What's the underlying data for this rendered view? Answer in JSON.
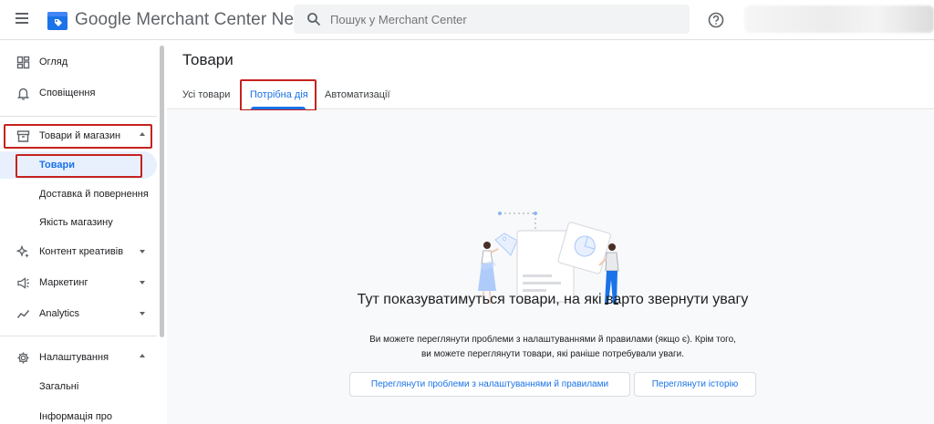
{
  "header": {
    "brand_google": "Google",
    "brand_product": "Merchant Center Next",
    "search_placeholder": "Пошук у Merchant Center",
    "icons": [
      "menu-icon",
      "merchant-center-logo",
      "search-icon",
      "help-icon"
    ]
  },
  "sidebar": {
    "overview": "Огляд",
    "notifications": "Сповіщення",
    "products_store": "Товари й магазин",
    "products": "Товари",
    "shipping_returns": "Доставка й повернення",
    "store_quality": "Якість магазину",
    "creative_content": "Контент креативів",
    "marketing": "Маркетинг",
    "analytics": "Analytics",
    "settings": "Налаштування",
    "general": "Загальні",
    "info_about": "Інформація про"
  },
  "main": {
    "page_title": "Товари",
    "tabs": [
      {
        "label": "Усі товари",
        "active": false
      },
      {
        "label": "Потрібна дія",
        "active": true
      },
      {
        "label": "Автоматизації",
        "active": false
      }
    ],
    "empty_state": {
      "title": "Тут показуватимуться товари, на які варто звернути увагу",
      "description_line1": "Ви можете переглянути проблеми з налаштуваннями й правилами (якщо є). Крім того,",
      "description_line2": "ви можете переглянути товари, які раніше потребували уваги.",
      "button_review_issues": "Переглянути проблеми з налаштуваннями й правилами",
      "button_history": "Переглянути історію"
    }
  },
  "colors": {
    "accent": "#1a73e8",
    "highlight_box": "#c5221f",
    "active_nav_bg": "#e8f0fe"
  }
}
